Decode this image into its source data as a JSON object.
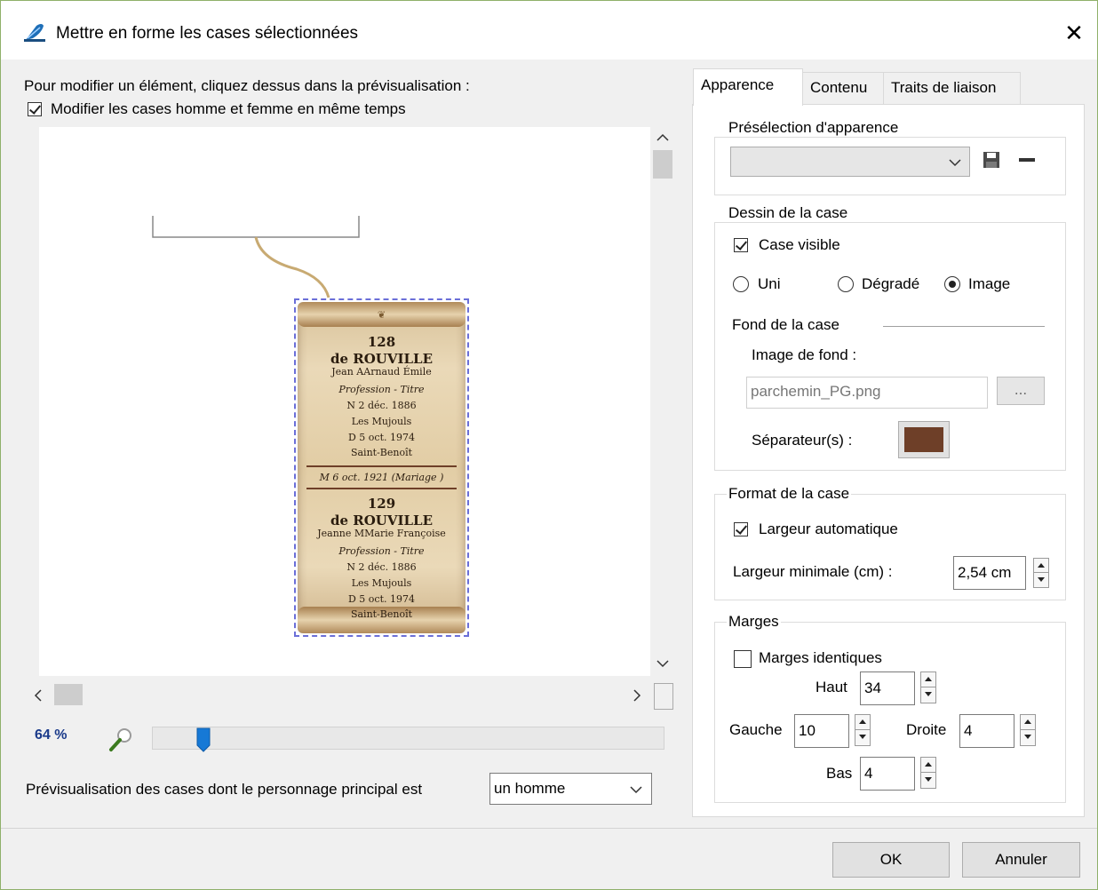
{
  "window": {
    "title": "Mettre en forme les cases sélectionnées",
    "close_glyph": "✕"
  },
  "left": {
    "instruction": "Pour modifier un élément, cliquez dessus dans la prévisualisation :",
    "modify_both_label": "Modifier les cases homme et femme en même temps",
    "modify_both_checked": true,
    "zoom_label": "64 %",
    "zoom_percent": 64,
    "preview_filter_label": "Prévisualisation des cases dont le personnage principal est",
    "preview_filter_value": "un homme"
  },
  "card": {
    "person1": {
      "number": "128",
      "surname": "de ROUVILLE",
      "given": "Jean AArnaud  Émile",
      "profession": "Profession  - Titre",
      "birth": "N 2 déc. 1886",
      "birth_place": "Les Mujouls",
      "death": "D 5 oct. 1974",
      "death_place": "Saint-Benoît"
    },
    "marriage": "M 6 oct. 1921 (Mariage )",
    "person2": {
      "number": "129",
      "surname": "de ROUVILLE",
      "given": "Jeanne MMarie  Françoise",
      "profession": "Profession  - Titre",
      "birth": "N 2 déc. 1886",
      "birth_place": "Les Mujouls",
      "death": "D 5 oct. 1974",
      "death_place": "Saint-Benoît"
    }
  },
  "tabs": [
    "Apparence",
    "Contenu",
    "Traits de liaison"
  ],
  "active_tab": "Apparence",
  "preset": {
    "title": "Présélection d'apparence",
    "value": ""
  },
  "drawing": {
    "title": "Dessin de la case",
    "visible_label": "Case visible",
    "visible_checked": true,
    "radio_uni": "Uni",
    "radio_gradient": "Dégradé",
    "radio_image": "Image",
    "selected": "Image",
    "background_title": "Fond de la case",
    "image_label": "Image de fond :",
    "image_value": "parchemin_PG.png",
    "browse_label": "...",
    "separator_label": "Séparateur(s) :",
    "separator_color": "#6e3f28"
  },
  "format": {
    "title": "Format de la case",
    "auto_width_label": "Largeur automatique",
    "auto_width_checked": true,
    "min_width_label": "Largeur minimale (cm) :",
    "min_width_value": "2,54 cm"
  },
  "margins": {
    "title": "Marges",
    "identical_label": "Marges identiques",
    "identical_checked": false,
    "top_label": "Haut",
    "top_value": "34",
    "left_label": "Gauche",
    "left_value": "10",
    "right_label": "Droite",
    "right_value": "4",
    "bottom_label": "Bas",
    "bottom_value": "4"
  },
  "buttons": {
    "ok": "OK",
    "cancel": "Annuler"
  }
}
